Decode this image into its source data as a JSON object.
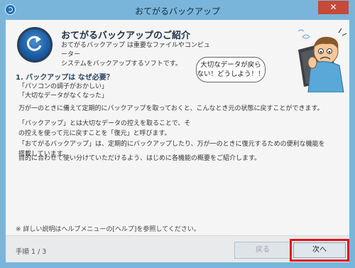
{
  "window": {
    "title": "おてがるバックアップ",
    "close_symbol": "✕",
    "icons": {
      "app": "app-backup-icon",
      "close": "close-icon"
    }
  },
  "intro": {
    "heading": "おてがるバックアップのご紹介",
    "description": [
      "おてがるバックアップ は重要なファイルやコンピューター",
      "システムをバックアップするソフトです。"
    ],
    "icon": "backup-restore-icon"
  },
  "illustration": {
    "bubble": [
      "大切なデータが戻ら",
      "ない！どうしよう！！"
    ]
  },
  "section1": {
    "title": "1. バックアップは なぜ必要？",
    "examples": [
      "「パソコンの調子がおかしい」",
      "「大切なデータがなくなった」"
    ],
    "paragraphs": [
      "万が一のときに備えて定期的にバックアップを取っておくと、こんなとき元の状態に戻すことができます。",
      "「バックアップ」とは大切なデータの控えを取ることで、その控えを使って元に戻すことを「復元」と呼びます。",
      "「おてがるバックアップ」は、定期的にバックアップしたり、万が一のときに復元するための便利な機能を搭載しています。",
      "目的に合わせて使い分けていただけるよう、はじめに各機能の概要をご紹介します。"
    ]
  },
  "note": "※ 詳しい説明はヘルプメニューの[ヘルプ]を参照してください。",
  "footer": {
    "step": "手順 1 / 3",
    "back_label": "戻る",
    "next_label": "次へ"
  },
  "colors": {
    "titlebar": "#79b5db",
    "close": "#c7493a",
    "highlight": "#e0141a",
    "heading": "#223447"
  }
}
